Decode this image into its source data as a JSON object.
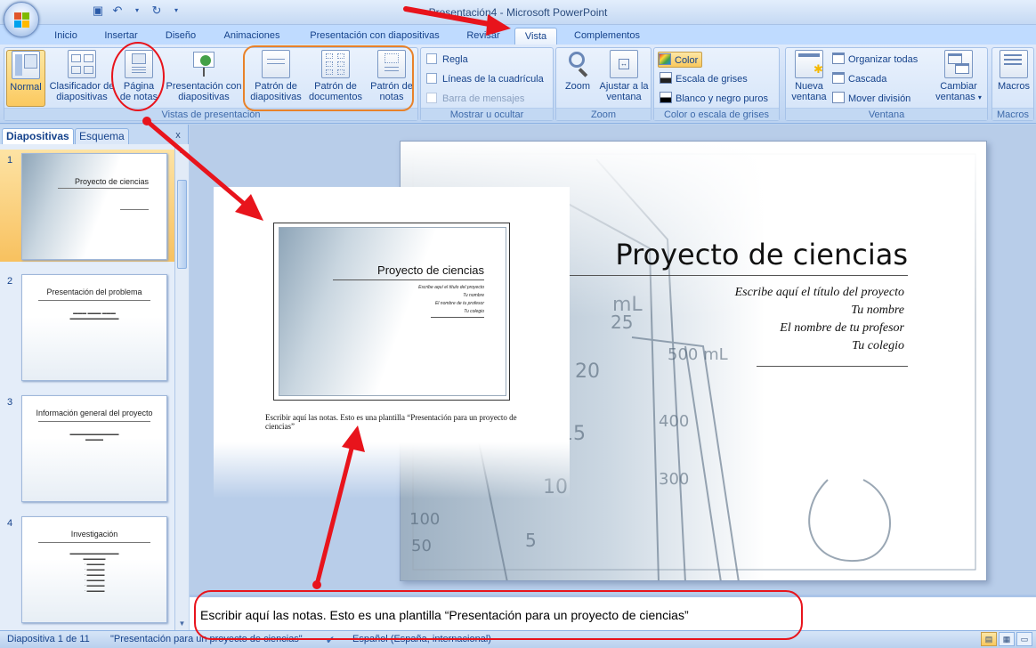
{
  "window": {
    "title": "Presentación4 - Microsoft PowerPoint"
  },
  "tabs": [
    {
      "label": "Inicio",
      "active": false
    },
    {
      "label": "Insertar",
      "active": false
    },
    {
      "label": "Diseño",
      "active": false
    },
    {
      "label": "Animaciones",
      "active": false
    },
    {
      "label": "Presentación con diapositivas",
      "active": false
    },
    {
      "label": "Revisar",
      "active": false
    },
    {
      "label": "Vista",
      "active": true
    },
    {
      "label": "Complementos",
      "active": false
    }
  ],
  "ribbon": {
    "vistas": {
      "label": "Vistas de presentación",
      "normal": "Normal",
      "clasificador": "Clasificador de diapositivas",
      "pagina_notas": "Página de notas",
      "presentacion": "Presentación con diapositivas",
      "patron_diapositivas": "Patrón de diapositivas",
      "patron_documentos": "Patrón de documentos",
      "patron_notas": "Patrón de notas"
    },
    "mostrar": {
      "label": "Mostrar u ocultar",
      "regla": "Regla",
      "lineas": "Líneas de la cuadrícula",
      "barra": "Barra de mensajes"
    },
    "zoom": {
      "label": "Zoom",
      "zoom": "Zoom",
      "ajustar": "Ajustar a la ventana"
    },
    "color": {
      "label": "Color o escala de grises",
      "color": "Color",
      "grises": "Escala de grises",
      "bn": "Blanco y negro puros"
    },
    "ventana": {
      "label": "Ventana",
      "nueva": "Nueva ventana",
      "organizar": "Organizar todas",
      "cascada": "Cascada",
      "mover": "Mover división",
      "cambiar": "Cambiar ventanas"
    },
    "macros": {
      "label": "Macros",
      "macros": "Macros"
    }
  },
  "left_pane": {
    "tab_diapositivas": "Diapositivas",
    "tab_esquema": "Esquema",
    "close": "x",
    "slides": [
      {
        "num": "1",
        "title": "Proyecto de ciencias",
        "selected": true
      },
      {
        "num": "2",
        "title": "Presentación del problema",
        "selected": false
      },
      {
        "num": "3",
        "title": "Información general del proyecto",
        "selected": false
      },
      {
        "num": "4",
        "title": "Investigación",
        "selected": false
      }
    ]
  },
  "slide": {
    "title": "Proyecto de ciencias",
    "subtitle_lines": [
      "Escribe aquí el título del proyecto",
      "Tu nombre",
      "El nombre de tu profesor",
      "Tu colegio"
    ]
  },
  "notes_page": {
    "thumb_title": "Proyecto de ciencias",
    "text": "Escribir aquí las notas. Esto es una plantilla “Presentación para un proyecto de ciencias”"
  },
  "notes_pane": {
    "text": "Escribir aquí las notas. Esto es una plantilla “Presentación para un proyecto de ciencias”"
  },
  "status": {
    "slide_count": "Diapositiva 1 de 11",
    "template": "\"Presentación para un proyecto de ciencias\"",
    "language": "Español (España, internacional)"
  },
  "colors": {
    "annotation_red": "#e8141c",
    "annotation_orange": "#e8822a",
    "ribbon_blue": "#15428b"
  }
}
